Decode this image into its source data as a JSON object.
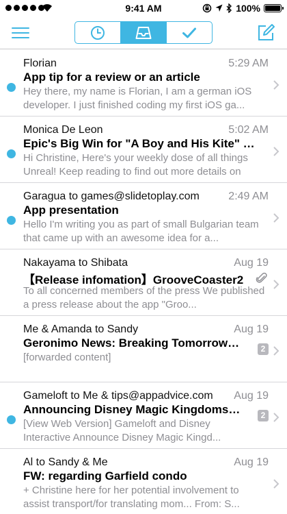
{
  "status_bar": {
    "time": "9:41 AM",
    "battery": "100%"
  },
  "nav": {
    "tabs": [
      {
        "name": "clock",
        "icon": "clock-icon",
        "active": false
      },
      {
        "name": "inbox",
        "icon": "inbox-icon",
        "active": true
      },
      {
        "name": "done",
        "icon": "checkmark-icon",
        "active": false
      }
    ]
  },
  "colors": {
    "accent": "#3fb6e2",
    "secondary_text": "#8e8e93",
    "badge": "#b8b8bd"
  },
  "messages": [
    {
      "sender": "Florian",
      "time": "5:29 AM",
      "subject": "App tip for a review or an article",
      "preview": "Hey there, my name is Florian, I am a german iOS developer. I just finished coding my first iOS ga...",
      "unread": true
    },
    {
      "sender": "Monica De Leon",
      "time": "5:02 AM",
      "subject": "Epic's Big Win for \"A Boy and His Kite\" +...",
      "preview": "Hi Christine, Here's your weekly dose of all things Unreal! Keep reading to find out more details on",
      "unread": true
    },
    {
      "sender": "Garagua to games@slidetoplay.com",
      "time": "2:49 AM",
      "subject": "App presentation",
      "preview": "Hello I'm writing you as part of small Bulgarian team that came up with an awesome idea for a...",
      "unread": true
    },
    {
      "sender": "Nakayama to Shibata",
      "time": "Aug 19",
      "subject": "【Release infomation】GrooveCoaster2",
      "preview": "To all concerned members of the press We published a press release about the app \"Groo...",
      "unread": false,
      "attachment": true
    },
    {
      "sender": "Me & Amanda to Sandy",
      "time": "Aug 19",
      "subject": "Geronimo News: Breaking Tomorrow (...",
      "preview": "[forwarded content]",
      "unread": false,
      "count": "2"
    },
    {
      "sender": "Gameloft to Me & tips@appadvice.com",
      "time": "Aug 19",
      "subject": "Announcing Disney Magic Kingdoms F...",
      "preview": "[View Web Version] Gameloft and Disney Interactive Announce Disney Magic Kingd...",
      "unread": true,
      "count": "2"
    },
    {
      "sender": "Al to Sandy & Me",
      "time": "Aug 19",
      "subject": "FW: regarding Garfield condo",
      "preview": "+ Christine here for her potential involvement to assist transport/for translating mom... From: S...",
      "unread": false
    }
  ]
}
